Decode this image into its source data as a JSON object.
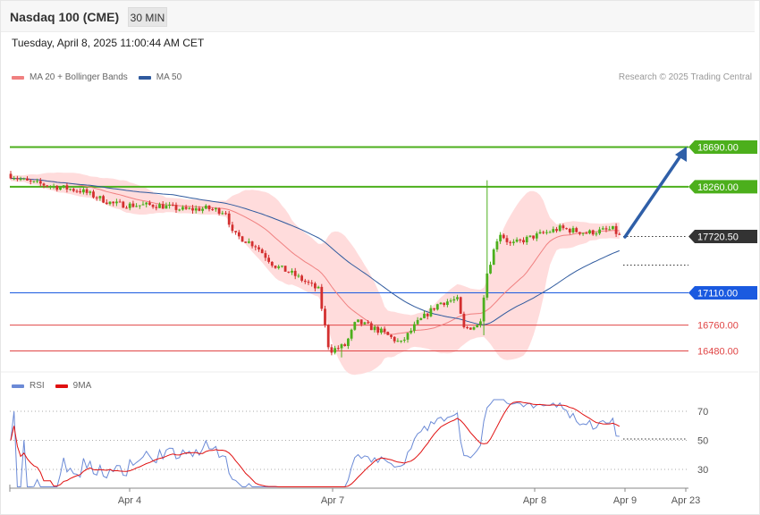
{
  "header": {
    "title": "Nasdaq 100 (CME)",
    "timeframe": "30 MIN"
  },
  "datetime": "Tuesday, April 8, 2025 11:00:44 AM CET",
  "legend": {
    "items": [
      {
        "label": "MA 20 + Bollinger Bands",
        "color": "#f08080"
      },
      {
        "label": "MA 50",
        "color": "#2f5a9e"
      }
    ],
    "credit": "Research © 2025 Trading Central"
  },
  "rsi_legend": {
    "items": [
      {
        "label": "RSI",
        "color": "#6b8ad6"
      },
      {
        "label": "9MA",
        "color": "#e01010"
      }
    ]
  },
  "chart_data": {
    "type": "candlestick",
    "x_ticks": [
      "Apr 4",
      "Apr 7",
      "Apr 8",
      "Apr 9",
      "Apr 23"
    ],
    "price_range": [
      16400,
      18850
    ],
    "levels": [
      {
        "value": 18690,
        "label": "18690.00",
        "color": "#4caf1c",
        "kind": "resistance"
      },
      {
        "value": 18260,
        "label": "18260.00",
        "color": "#4caf1c",
        "kind": "resistance"
      },
      {
        "value": 17720.5,
        "label": "17720.50",
        "color": "#333333",
        "kind": "last"
      },
      {
        "value": 17110,
        "label": "17110.00",
        "color": "#1a5ae0",
        "kind": "pivot"
      },
      {
        "value": 16760,
        "label": "16760.00",
        "color": "#e04545",
        "kind": "support"
      },
      {
        "value": 16480,
        "label": "16480.00",
        "color": "#e04545",
        "kind": "support"
      }
    ],
    "rsi": {
      "levels": [
        70,
        50,
        30
      ],
      "range": [
        10,
        90
      ]
    }
  },
  "colors": {
    "up": "#4caf1c",
    "down": "#d32f2f",
    "band": "#ffd6d6",
    "ma20": "#f08080",
    "ma50": "#2f5a9e",
    "rsi": "#6b8ad6",
    "rsi_ma": "#e01010",
    "arrow": "#2f5fa8"
  }
}
